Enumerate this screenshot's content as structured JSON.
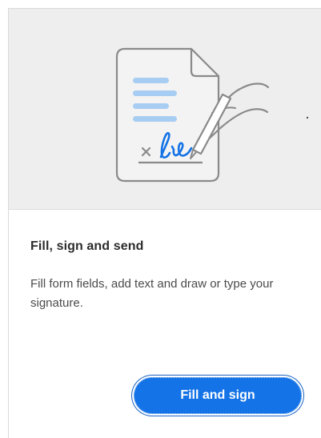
{
  "card": {
    "title": "Fill, sign and send",
    "description": "Fill form fields, add text and draw or type your signature.",
    "button_label": "Fill and sign"
  },
  "illustration": {
    "icon": "fill-sign-document-illustration",
    "accent_color": "#1473e6",
    "line_color": "#9ccaf5",
    "outline_color": "#8a8a8a"
  }
}
